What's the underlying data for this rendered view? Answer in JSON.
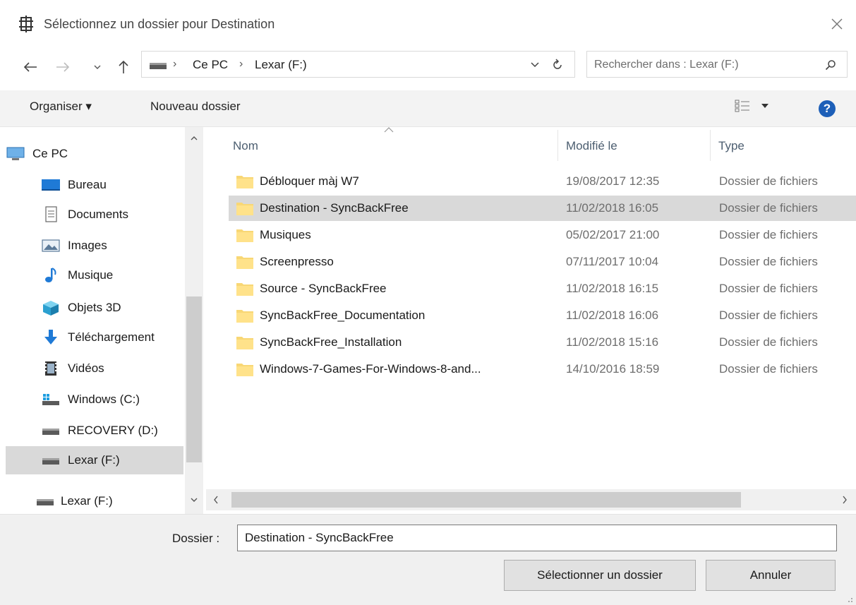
{
  "dialog": {
    "title": "Sélectionnez un dossier pour Destination"
  },
  "address": {
    "crumbs": [
      "Ce PC",
      "Lexar (F:)"
    ],
    "separator": "›"
  },
  "search": {
    "placeholder": "Rechercher dans : Lexar (F:)"
  },
  "toolbar": {
    "organize_label": "Organiser ▾",
    "new_folder_label": "Nouveau dossier",
    "help_label": "?"
  },
  "navpane": {
    "items": [
      {
        "label": "Ce PC",
        "icon": "computer-icon"
      },
      {
        "label": "Bureau",
        "icon": "desktop-icon"
      },
      {
        "label": "Documents",
        "icon": "documents-icon"
      },
      {
        "label": "Images",
        "icon": "images-icon"
      },
      {
        "label": "Musique",
        "icon": "music-icon"
      },
      {
        "label": "Objets 3D",
        "icon": "3d-objects-icon"
      },
      {
        "label": "Téléchargement",
        "icon": "download-icon"
      },
      {
        "label": "Vidéos",
        "icon": "videos-icon"
      },
      {
        "label": "Windows (C:)",
        "icon": "windows-drive-icon"
      },
      {
        "label": "RECOVERY (D:)",
        "icon": "drive-icon"
      },
      {
        "label": "Lexar (F:)",
        "icon": "usb-drive-icon"
      },
      {
        "label": "Lexar (F:)",
        "icon": "usb-drive-icon"
      }
    ],
    "selected_index": 10
  },
  "columns": {
    "name": "Nom",
    "modified": "Modifié le",
    "type": "Type"
  },
  "files": [
    {
      "name": "Débloquer màj W7",
      "modified": "19/08/2017 12:35",
      "type": "Dossier de fichiers"
    },
    {
      "name": "Destination - SyncBackFree",
      "modified": "11/02/2018 16:05",
      "type": "Dossier de fichiers"
    },
    {
      "name": "Musiques",
      "modified": "05/02/2017 21:00",
      "type": "Dossier de fichiers"
    },
    {
      "name": "Screenpresso",
      "modified": "07/11/2017 10:04",
      "type": "Dossier de fichiers"
    },
    {
      "name": "Source - SyncBackFree",
      "modified": "11/02/2018 16:15",
      "type": "Dossier de fichiers"
    },
    {
      "name": "SyncBackFree_Documentation",
      "modified": "11/02/2018 16:06",
      "type": "Dossier de fichiers"
    },
    {
      "name": "SyncBackFree_Installation",
      "modified": "11/02/2018 15:16",
      "type": "Dossier de fichiers"
    },
    {
      "name": "Windows-7-Games-For-Windows-8-and...",
      "modified": "14/10/2016 18:59",
      "type": "Dossier de fichiers"
    }
  ],
  "selected_file_index": 1,
  "footer": {
    "folder_label": "Dossier :",
    "folder_value": "Destination - SyncBackFree",
    "select_label": "Sélectionner un dossier",
    "cancel_label": "Annuler"
  },
  "colors": {
    "selection": "#d9d9d9",
    "folder": "#f8d775",
    "help": "#1d5fb8",
    "header_text": "#4c5e70"
  }
}
